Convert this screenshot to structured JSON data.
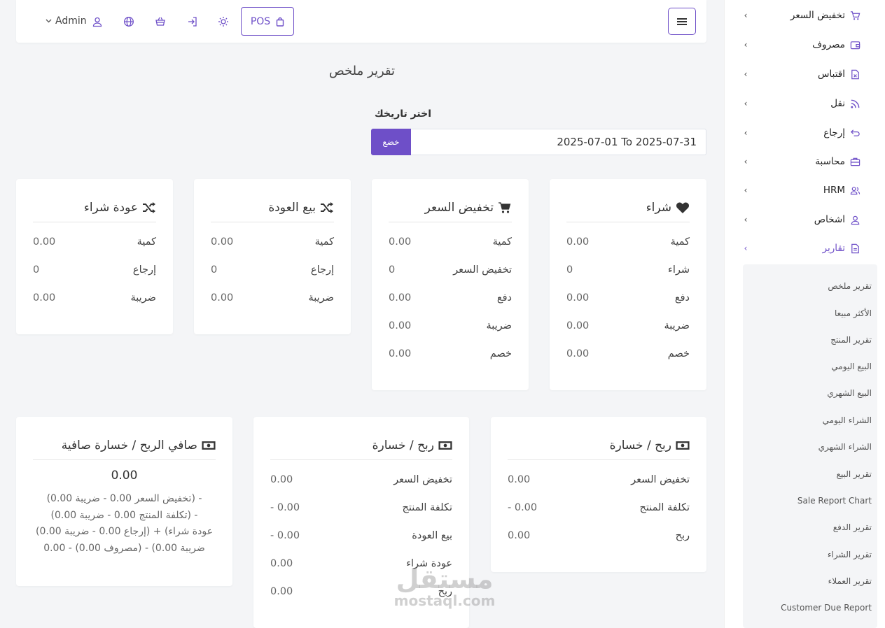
{
  "topbar": {
    "pos_label": "POS",
    "admin_label": "Admin",
    "accent": "#6e4fc8"
  },
  "page": {
    "title": "تقرير ملخص",
    "date_label": "اختر تاريخك",
    "date_value": "2025-07-01 To 2025-07-31",
    "submit_label": "خضع"
  },
  "sidebar": {
    "items": [
      {
        "label": "تخفيض السعر",
        "icon": "cart-icon"
      },
      {
        "label": "مصروف",
        "icon": "wallet-icon"
      },
      {
        "label": "اقتباس",
        "icon": "file-icon"
      },
      {
        "label": "نقل",
        "icon": "rss-icon"
      },
      {
        "label": "إرجاع",
        "icon": "return-icon"
      },
      {
        "label": "محاسبة",
        "icon": "briefcase-icon"
      },
      {
        "label": "HRM",
        "icon": "users-icon"
      },
      {
        "label": "اشخاص",
        "icon": "user-icon"
      },
      {
        "label": "تقارير",
        "icon": "report-icon"
      }
    ],
    "submenu": [
      "تقرير ملخص",
      "الأكثر مبيعا",
      "تقرير المنتج",
      "البيع اليومي",
      "البيع الشهري",
      "الشراء اليومي",
      "الشراء الشهري",
      "تقرير البيع",
      "Sale Report Chart",
      "تقرير الدفع",
      "تقرير الشراء",
      "تقرير العملاء",
      "Customer Due Report"
    ]
  },
  "cards_top": [
    {
      "title": "شراء",
      "icon": "heart-icon",
      "rows": [
        {
          "label": "كمية",
          "value": "0.00"
        },
        {
          "label": "شراء",
          "value": "0"
        },
        {
          "label": "دفع",
          "value": "0.00"
        },
        {
          "label": "ضريبة",
          "value": "0.00"
        },
        {
          "label": "خصم",
          "value": "0.00"
        }
      ]
    },
    {
      "title": "تخفيض السعر",
      "icon": "cart-icon",
      "rows": [
        {
          "label": "كمية",
          "value": "0.00"
        },
        {
          "label": "تخفيض السعر",
          "value": "0"
        },
        {
          "label": "دفع",
          "value": "0.00"
        },
        {
          "label": "ضريبة",
          "value": "0.00"
        },
        {
          "label": "خصم",
          "value": "0.00"
        }
      ]
    },
    {
      "title": "بيع العودة",
      "icon": "shuffle-icon",
      "rows": [
        {
          "label": "كمية",
          "value": "0.00"
        },
        {
          "label": "إرجاع",
          "value": "0"
        },
        {
          "label": "ضريبة",
          "value": "0.00"
        }
      ]
    },
    {
      "title": "عودة شراء",
      "icon": "shuffle-icon",
      "rows": [
        {
          "label": "كمية",
          "value": "0.00"
        },
        {
          "label": "إرجاع",
          "value": "0"
        },
        {
          "label": "ضريبة",
          "value": "0.00"
        }
      ]
    }
  ],
  "cards_bottom": [
    {
      "title": "ربح / خسارة",
      "icon": "money-icon",
      "rows": [
        {
          "label": "تخفيض السعر",
          "value": "0.00"
        },
        {
          "label": "تكلفة المنتج",
          "value": "- 0.00"
        },
        {
          "label": "ربح",
          "value": "0.00"
        }
      ]
    },
    {
      "title": "ربح / خسارة",
      "icon": "money-icon",
      "rows": [
        {
          "label": "تخفيض السعر",
          "value": "0.00"
        },
        {
          "label": "تكلفة المنتج",
          "value": "- 0.00"
        },
        {
          "label": "بيع العودة",
          "value": "- 0.00"
        },
        {
          "label": "عودة شراء",
          "value": "0.00"
        },
        {
          "label": "ربح",
          "value": "0.00"
        }
      ]
    }
  ],
  "net_card": {
    "title": "صافي الربح / خسارة صافية",
    "icon": "money-icon",
    "value": "0.00",
    "line1": "(تخفيض السعر 0.00 - ضريبة 0.00) -",
    "line2": "(تكلفة المنتج 0.00 - ضريبة 0.00) -",
    "line3": "(إرجاع 0.00 - ضريبة 0.00) + (عودة شراء",
    "line4": "0.00 - ضريبة 0.00) - (مصروف 0.00)"
  },
  "watermark": {
    "line1": "مستقل",
    "line2": "mostaql.com"
  }
}
